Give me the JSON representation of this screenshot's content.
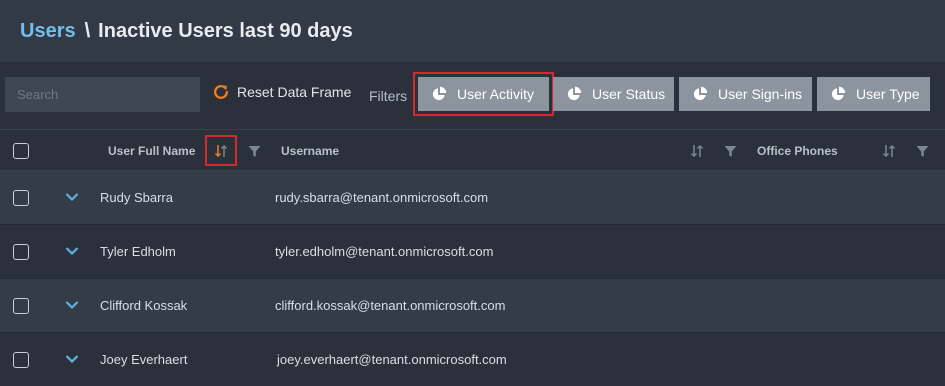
{
  "breadcrumb": {
    "parent": "Users",
    "separator": "\\",
    "current": "Inactive Users last 90 days"
  },
  "toolbar": {
    "search_placeholder": "Search",
    "reset_label": "Reset Data Frame",
    "filters_label": "Filters",
    "filter_buttons": [
      {
        "label": "User Activity",
        "active": true
      },
      {
        "label": "User Status",
        "active": false
      },
      {
        "label": "User Sign-ins",
        "active": false
      },
      {
        "label": "User Type",
        "active": false
      }
    ]
  },
  "table": {
    "columns": {
      "full_name": "User Full Name",
      "username": "Username",
      "office_phones": "Office Phones"
    },
    "rows": [
      {
        "full_name": "Rudy Sbarra",
        "username": "rudy.sbarra@tenant.onmicrosoft.com"
      },
      {
        "full_name": "Tyler Edholm",
        "username": "tyler.edholm@tenant.onmicrosoft.com"
      },
      {
        "full_name": "Clifford Kossak",
        "username": "clifford.kossak@tenant.onmicrosoft.com"
      },
      {
        "full_name": "Joey Everhaert",
        "username": "joey.everhaert@tenant.onmicrosoft.com"
      }
    ]
  },
  "colors": {
    "accent": "#6fbfe9",
    "reset_icon": "#f07c1e",
    "highlight": "#d8282f",
    "sort_active": "#f07c1e"
  },
  "icons": {
    "reset": "reset-icon",
    "filter_button": "pie-chart-icon",
    "sort": "sort-icon",
    "filter": "filter-icon",
    "expand": "chevron-down-icon"
  }
}
